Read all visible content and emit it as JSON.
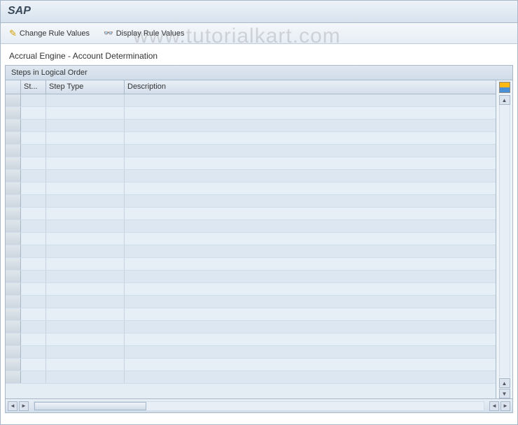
{
  "title": "SAP",
  "toolbar": {
    "change_label": "Change Rule Values",
    "display_label": "Display Rule Values"
  },
  "breadcrumb": "Accrual Engine - Account Determination",
  "panel_title": "Steps in Logical Order",
  "columns": {
    "step_short": "St...",
    "step_type": "Step Type",
    "description": "Description"
  },
  "rows": [
    {
      "st": "",
      "type": "",
      "desc": ""
    },
    {
      "st": "",
      "type": "",
      "desc": ""
    },
    {
      "st": "",
      "type": "",
      "desc": ""
    },
    {
      "st": "",
      "type": "",
      "desc": ""
    },
    {
      "st": "",
      "type": "",
      "desc": ""
    },
    {
      "st": "",
      "type": "",
      "desc": ""
    },
    {
      "st": "",
      "type": "",
      "desc": ""
    },
    {
      "st": "",
      "type": "",
      "desc": ""
    },
    {
      "st": "",
      "type": "",
      "desc": ""
    },
    {
      "st": "",
      "type": "",
      "desc": ""
    },
    {
      "st": "",
      "type": "",
      "desc": ""
    },
    {
      "st": "",
      "type": "",
      "desc": ""
    },
    {
      "st": "",
      "type": "",
      "desc": ""
    },
    {
      "st": "",
      "type": "",
      "desc": ""
    },
    {
      "st": "",
      "type": "",
      "desc": ""
    },
    {
      "st": "",
      "type": "",
      "desc": ""
    },
    {
      "st": "",
      "type": "",
      "desc": ""
    },
    {
      "st": "",
      "type": "",
      "desc": ""
    },
    {
      "st": "",
      "type": "",
      "desc": ""
    },
    {
      "st": "",
      "type": "",
      "desc": ""
    },
    {
      "st": "",
      "type": "",
      "desc": ""
    },
    {
      "st": "",
      "type": "",
      "desc": ""
    },
    {
      "st": "",
      "type": "",
      "desc": ""
    }
  ],
  "watermark": "www.tutorialkart.com"
}
